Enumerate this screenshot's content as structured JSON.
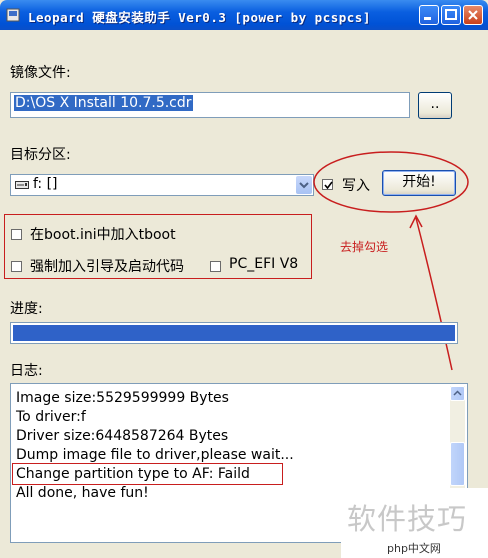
{
  "window": {
    "title": "Leopard 硬盘安装助手 Ver0.3 [power by pcspcs]"
  },
  "image_file": {
    "label": "镜像文件:",
    "value": "D:\\OS X Install 10.7.5.cdr",
    "browse_label": ".."
  },
  "target": {
    "label": "目标分区:",
    "selected": "f: []",
    "write_label": "写入",
    "write_checked": true,
    "start_label": "开始!"
  },
  "options": {
    "tboot_label": "在boot.ini中加入tboot",
    "force_label": "强制加入引导及启动代码",
    "pcefi_label": "PC_EFI V8"
  },
  "annotation": "去掉勾选",
  "progress": {
    "label": "进度:",
    "percent": 100
  },
  "log": {
    "label": "日志:",
    "lines": [
      "Image size:5529599999 Bytes",
      "To driver:f",
      "Driver size:6448587264 Bytes",
      "Dump image file to driver,please wait...",
      "Change partition type to AF: Faild",
      "All done, have fun!"
    ]
  },
  "watermark": {
    "text": "软件技巧",
    "logo": "php中文网"
  },
  "colors": {
    "selection": "#316ac5",
    "annotation": "#c81e1e",
    "progress": "#2f62c8"
  }
}
